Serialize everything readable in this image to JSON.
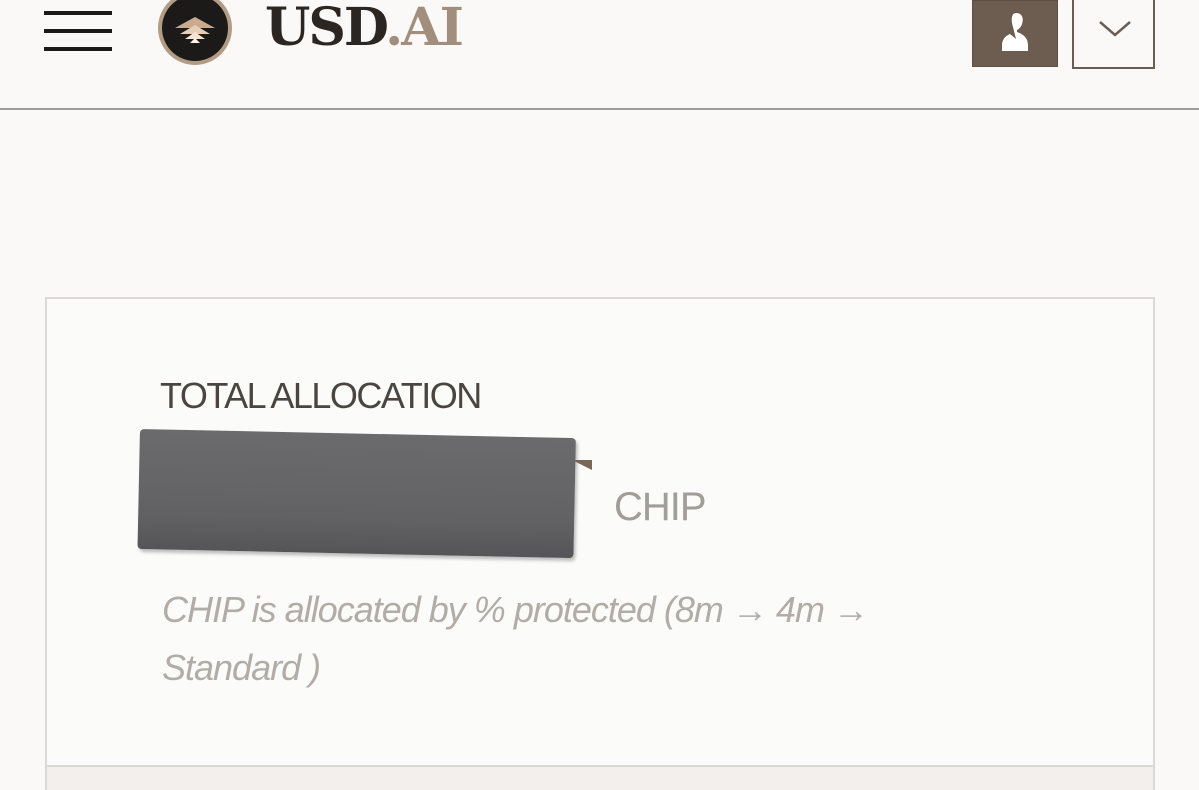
{
  "header": {
    "brand_primary": "USD",
    "brand_accent": ".AI",
    "icons": {
      "menu": "hamburger-menu-icon",
      "logo": "usd-ai-logo",
      "account": "user-icon",
      "dropdown": "chevron-down-icon"
    }
  },
  "allocation": {
    "title": "TOTAL ALLOCATION",
    "unit": "CHIP",
    "description": "CHIP is allocated by % protected (8m → 4m → Standard )"
  },
  "colors": {
    "background": "#faf9f8",
    "brand_dark": "#2b2622",
    "brand_accent": "#a28e7d",
    "button_fill": "#6d5d51",
    "muted_text": "#b1aca7"
  }
}
